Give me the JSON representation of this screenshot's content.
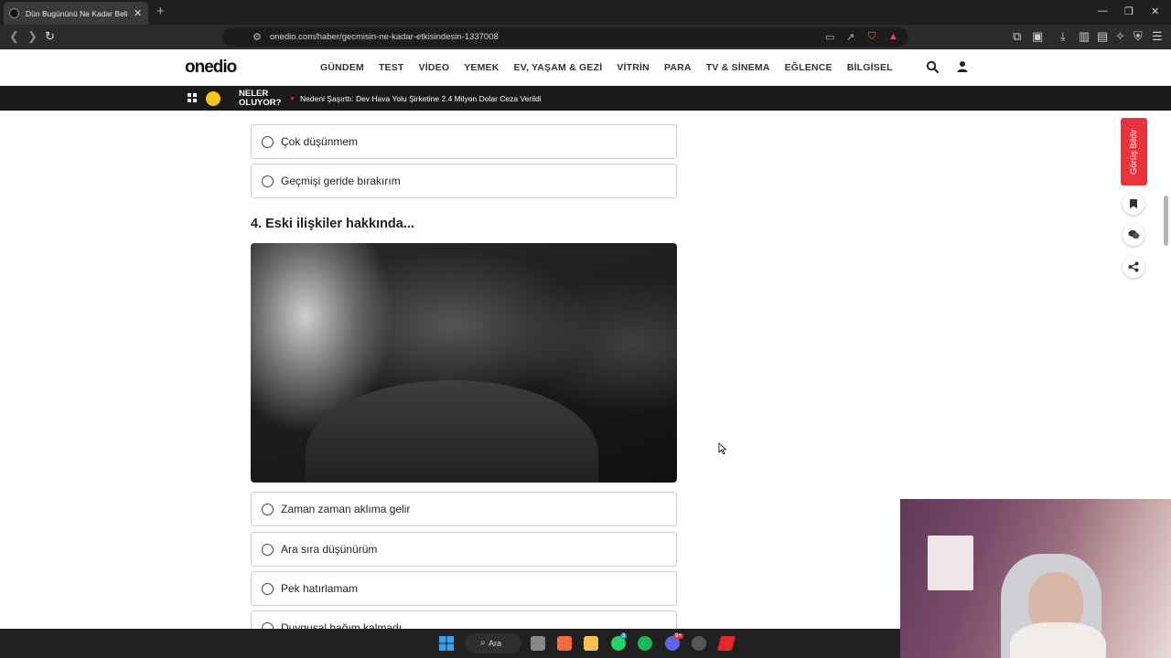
{
  "browser": {
    "tab_title": "Dün Bugününü Ne Kadar Belirliyor?",
    "url": "onedio.com/haber/gecmisin-ne-kadar-etkisindesin-1337008"
  },
  "site": {
    "logo": "onedio",
    "nav": [
      "GÜNDEM",
      "TEST",
      "VİDEO",
      "YEMEK",
      "EV, YAŞAM & GEZİ",
      "VİTRİN",
      "PARA",
      "TV & SİNEMA",
      "EĞLENCE",
      "BİLGİSEL"
    ],
    "news_label_line1": "NELER",
    "news_label_line2": "OLUYOR?",
    "news_headline": "Nedeni Şaşırttı: Dev Hava Yolu Şirketine 2.4 Milyon Dolar Ceza Verildi"
  },
  "quiz": {
    "prev_options": [
      "Çok düşünmem",
      "Geçmişi geride bırakırım"
    ],
    "question": "4. Eski ilişkiler hakkında...",
    "options": [
      "Zaman zaman aklıma gelir",
      "Ara sıra düşünürüm",
      "Pek hatırlamam",
      "Duygusal bağım kalmadı"
    ]
  },
  "sidebar": {
    "feedback_label": "Görüş Bildir"
  },
  "taskbar": {
    "search_label": "Ara",
    "whatsapp_badge": "3",
    "discord_badge": "9+"
  }
}
